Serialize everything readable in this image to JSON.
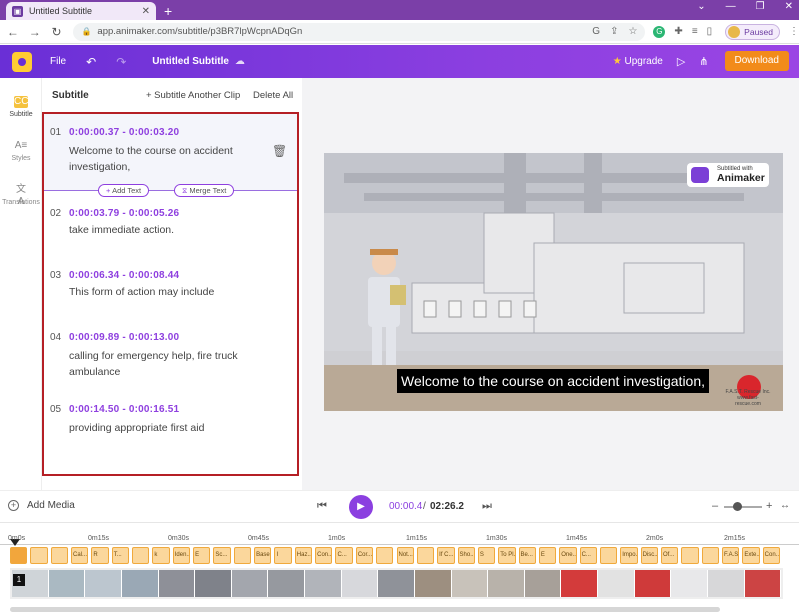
{
  "browser": {
    "tab_title": "Untitled Subtitle",
    "url": "app.animaker.com/subtitle/p3BR7lpWcpnADqGn",
    "profile_status": "Paused"
  },
  "header": {
    "file_label": "File",
    "project_title": "Untitled Subtitle",
    "upgrade_label": "Upgrade",
    "download_label": "Download"
  },
  "rail": {
    "items": [
      {
        "label": "Subtitle",
        "icon": "cc-icon",
        "active": true
      },
      {
        "label": "Styles",
        "icon": "styles-icon",
        "active": false
      },
      {
        "label": "Translations",
        "icon": "translate-icon",
        "active": false
      }
    ]
  },
  "panel": {
    "title": "Subtitle",
    "subtitle_another_label": "+ Subtitle Another Clip",
    "delete_all_label": "Delete All",
    "add_text_label": "Add Text",
    "merge_text_label": "Merge Text",
    "entries": [
      {
        "num": "01",
        "time": "0:00:00.37 - 0:00:03.20",
        "text": "Welcome to the course on accident investigation,"
      },
      {
        "num": "02",
        "time": "0:00:03.79 - 0:00:05.26",
        "text": "take immediate action."
      },
      {
        "num": "03",
        "time": "0:00:06.34 - 0:00:08.44",
        "text": "This form of action may include"
      },
      {
        "num": "04",
        "time": "0:00:09.89 - 0:00:13.00",
        "text": "calling for emergency help, fire truck ambulance"
      },
      {
        "num": "05",
        "time": "0:00:14.50 - 0:00:16.51",
        "text": "providing appropriate first aid"
      }
    ]
  },
  "video": {
    "badge_small": "Subtitled with",
    "badge_large": "Animaker",
    "caption": "Welcome to the course on accident investigation,",
    "brand_text": "F.A.S.T. Rescue Inc. www.fast-rescue.com"
  },
  "controls": {
    "add_media_label": "Add Media",
    "current_time": "00:00.4",
    "separator": "/",
    "total_time": "02:26.2",
    "zoom_level": 0.3
  },
  "timeline": {
    "ticks": [
      "0m0s",
      "0m15s",
      "0m30s",
      "0m45s",
      "1m0s",
      "1m15s",
      "1m30s",
      "1m45s",
      "2m0s",
      "2m15s"
    ],
    "chips": [
      "",
      "",
      "",
      "Cal...",
      "R",
      "T...",
      "",
      "k",
      "Iden...",
      "E",
      "Sc...",
      "",
      "Base...",
      "I",
      "Haz...",
      "Con...",
      "C...",
      "Cor...",
      "",
      "Not...",
      "",
      "If C...",
      "Sho...",
      "S",
      "To Pl...",
      "Be...",
      "E",
      "One...",
      "C...",
      "",
      "Impo...",
      "Disc...",
      "Of...",
      "",
      "",
      "F.A.S.T...",
      "Exte...",
      "Con..."
    ],
    "thumb_number": "1"
  }
}
